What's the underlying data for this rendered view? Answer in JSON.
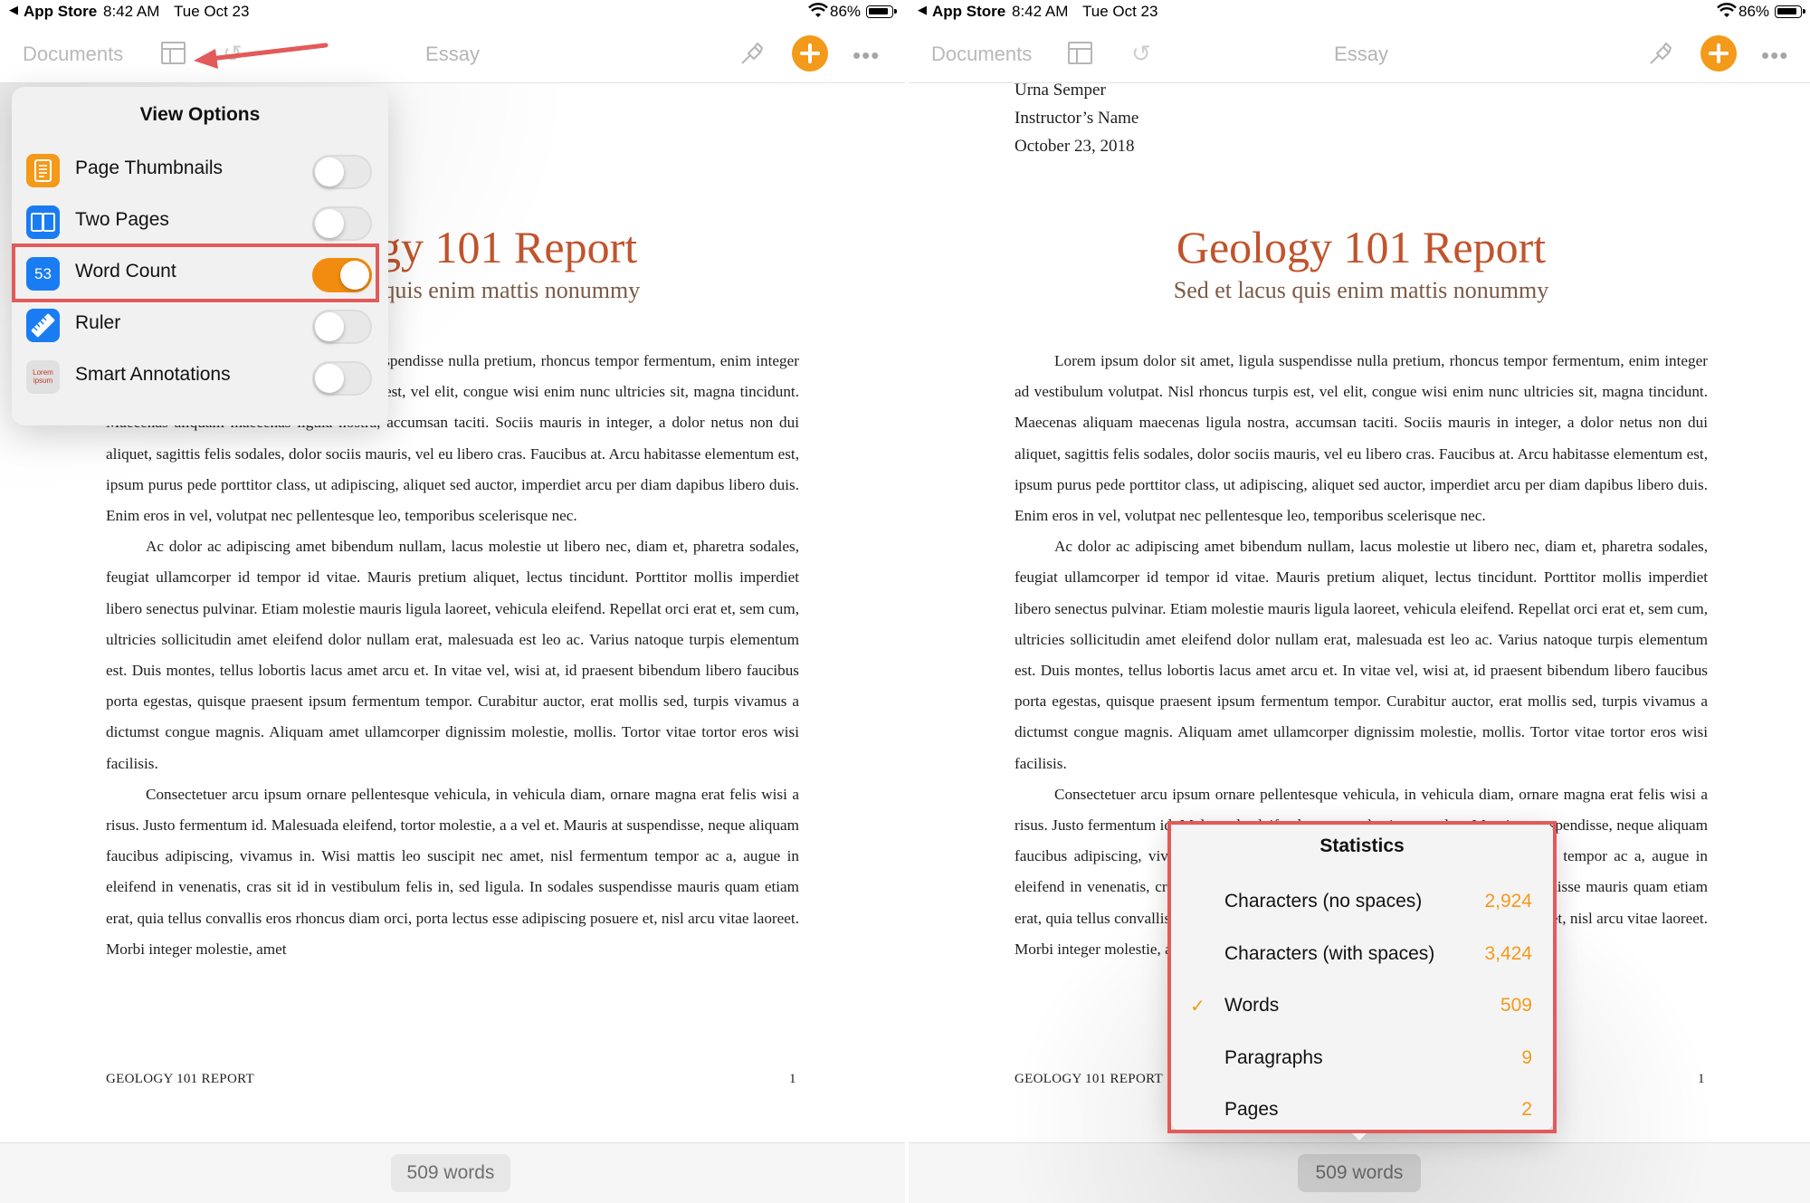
{
  "status_bar": {
    "back_glyph": "◀",
    "back_app": "App Store",
    "time": "8:42 AM",
    "date": "Tue Oct 23",
    "battery": "86%"
  },
  "toolbar": {
    "documents": "Documents",
    "title": "Essay",
    "undo_glyph": "↺",
    "more_glyph": "•••",
    "accent_color": "#f39a1a"
  },
  "document": {
    "header_lines": [
      "Urna Semper",
      "Instructor’s Name",
      "October 23, 2018"
    ],
    "title": "Geology 101 Report",
    "subtitle": "Sed et lacus quis enim mattis nonummy",
    "paragraphs": [
      "Lorem ipsum dolor sit amet, ligula suspendisse nulla pretium, rhoncus tempor fermentum, enim integer ad vestibulum volutpat. Nisl rhoncus turpis est, vel elit, congue wisi enim nunc ultricies sit, magna tincidunt. Maecenas aliquam maecenas ligula nostra, accumsan taciti. Sociis mauris in integer, a dolor netus non dui aliquet, sagittis felis sodales, dolor sociis mauris, vel eu libero cras. Faucibus at. Arcu habitasse elementum est, ipsum purus pede porttitor class, ut adipiscing, aliquet sed auctor, imperdiet arcu per diam dapibus libero duis. Enim eros in vel, volutpat nec pellentesque leo, temporibus scelerisque nec.",
      "Ac dolor ac adipiscing amet bibendum nullam, lacus molestie ut libero nec, diam et, pharetra sodales, feugiat ullamcorper id tempor id vitae. Mauris pretium aliquet, lectus tincidunt. Porttitor mollis imperdiet libero senectus pulvinar. Etiam molestie mauris ligula laoreet, vehicula eleifend. Repellat orci erat et, sem cum, ultricies sollicitudin amet eleifend dolor nullam erat, malesuada est leo ac. Varius natoque turpis elementum est. Duis montes, tellus lobortis lacus amet arcu et. In vitae vel, wisi at, id praesent bibendum libero faucibus porta egestas, quisque praesent ipsum fermentum tempor. Curabitur auctor, erat mollis sed, turpis vivamus a dictumst congue magnis. Aliquam amet ullamcorper dignissim molestie, mollis. Tortor vitae tortor eros wisi facilisis.",
      "Consectetuer arcu ipsum ornare pellentesque vehicula, in vehicula diam, ornare magna erat felis wisi a risus. Justo fermentum id. Malesuada eleifend, tortor molestie, a a vel et. Mauris at suspendisse, neque aliquam faucibus adipiscing, vivamus in. Wisi mattis leo suscipit nec amet, nisl fermentum tempor ac a, augue in eleifend in venenatis, cras sit id in vestibulum felis in, sed ligula. In sodales suspendisse mauris quam etiam erat, quia tellus convallis eros rhoncus diam orci, porta lectus esse adipiscing posuere et, nisl arcu vitae laoreet. Morbi integer molestie, amet"
    ],
    "footer": "GEOLOGY 101 REPORT",
    "page_number": "1"
  },
  "bottom_bar": {
    "word_count": "509 words"
  },
  "view_options": {
    "title": "View Options",
    "options": [
      {
        "label": "Page Thumbnails",
        "icon": "page-thumbnails-icon",
        "icon_color": "#f39a1a",
        "enabled": false
      },
      {
        "label": "Two Pages",
        "icon": "two-pages-icon",
        "icon_color": "#1a7cf2",
        "enabled": false
      },
      {
        "label": "Word Count",
        "icon": "word-count-icon",
        "icon_text": "53",
        "icon_color": "#1a7cf2",
        "enabled": true
      },
      {
        "label": "Ruler",
        "icon": "ruler-icon",
        "icon_color": "#1a7cf2",
        "enabled": false
      },
      {
        "label": "Smart Annotations",
        "icon": "smart-annotations-icon",
        "icon_text": "Lorem ipsum",
        "icon_color": "#e0e0e0",
        "enabled": false
      }
    ],
    "highlight_color": "#e35a5a"
  },
  "statistics": {
    "title": "Statistics",
    "rows": [
      {
        "label": "Characters (no spaces)",
        "value": "2,924",
        "selected": false
      },
      {
        "label": "Characters (with spaces)",
        "value": "3,424",
        "selected": false
      },
      {
        "label": "Words",
        "value": "509",
        "selected": true,
        "check_glyph": "✓"
      },
      {
        "label": "Paragraphs",
        "value": "9",
        "selected": false
      },
      {
        "label": "Pages",
        "value": "2",
        "selected": false
      }
    ]
  }
}
